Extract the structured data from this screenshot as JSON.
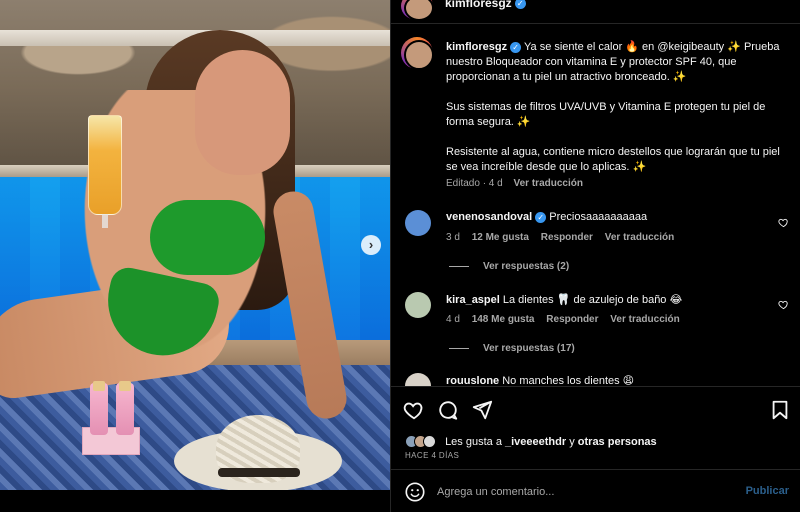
{
  "post": {
    "username": "kimfloresgz",
    "more_icon": "more-horizontal-icon"
  },
  "caption": {
    "username": "kimfloresgz",
    "line1": "Ya se siente el calor 🔥 en @keigibeauty ✨ Prueba nuestro Bloqueador con vitamina E y protector SPF 40, que proporcionan a tu piel un atractivo bronceado. ✨",
    "line2": "Sus sistemas de filtros UVA/UVB y Vitamina E protegen tu piel de forma segura. ✨",
    "line3": "Resistente al agua, contiene micro destellos que lograrán que tu piel se vea increíble desde que lo aplicas. ✨",
    "edited": "Editado · 4 d",
    "translate": "Ver traducción"
  },
  "comments": [
    {
      "username": "venenosandoval",
      "verified": true,
      "text": "Preciosaaaaaaaaaa",
      "time": "3 d",
      "likes": "12 Me gusta",
      "reply": "Responder",
      "translate": "Ver traducción",
      "view_replies": "Ver respuestas (2)",
      "avatar_color": "#5b8fd6"
    },
    {
      "username": "kira_aspel",
      "verified": false,
      "text": "La dientes 🦷 de azulejo de baño 😂",
      "time": "4 d",
      "likes": "148 Me gusta",
      "reply": "Responder",
      "translate": "Ver traducción",
      "view_replies": "Ver respuestas (17)",
      "avatar_color": "#b9c9b0"
    },
    {
      "username": "rouuslone",
      "verified": false,
      "text": "No manches los dientes 😩",
      "avatar_color": "#d8d2c8"
    }
  ],
  "actions": {
    "likes_prefix": "Les gusta a",
    "likes_user": "_iveeeethdr",
    "likes_joiner": "y",
    "likes_others": "otras personas",
    "time_ago": "HACE 4 DÍAS"
  },
  "composer": {
    "placeholder": "Agrega un comentario...",
    "publish": "Publicar"
  },
  "colors": {
    "background": "#000000",
    "verified": "#3897f0",
    "publish_disabled": "#2b5f8c"
  }
}
